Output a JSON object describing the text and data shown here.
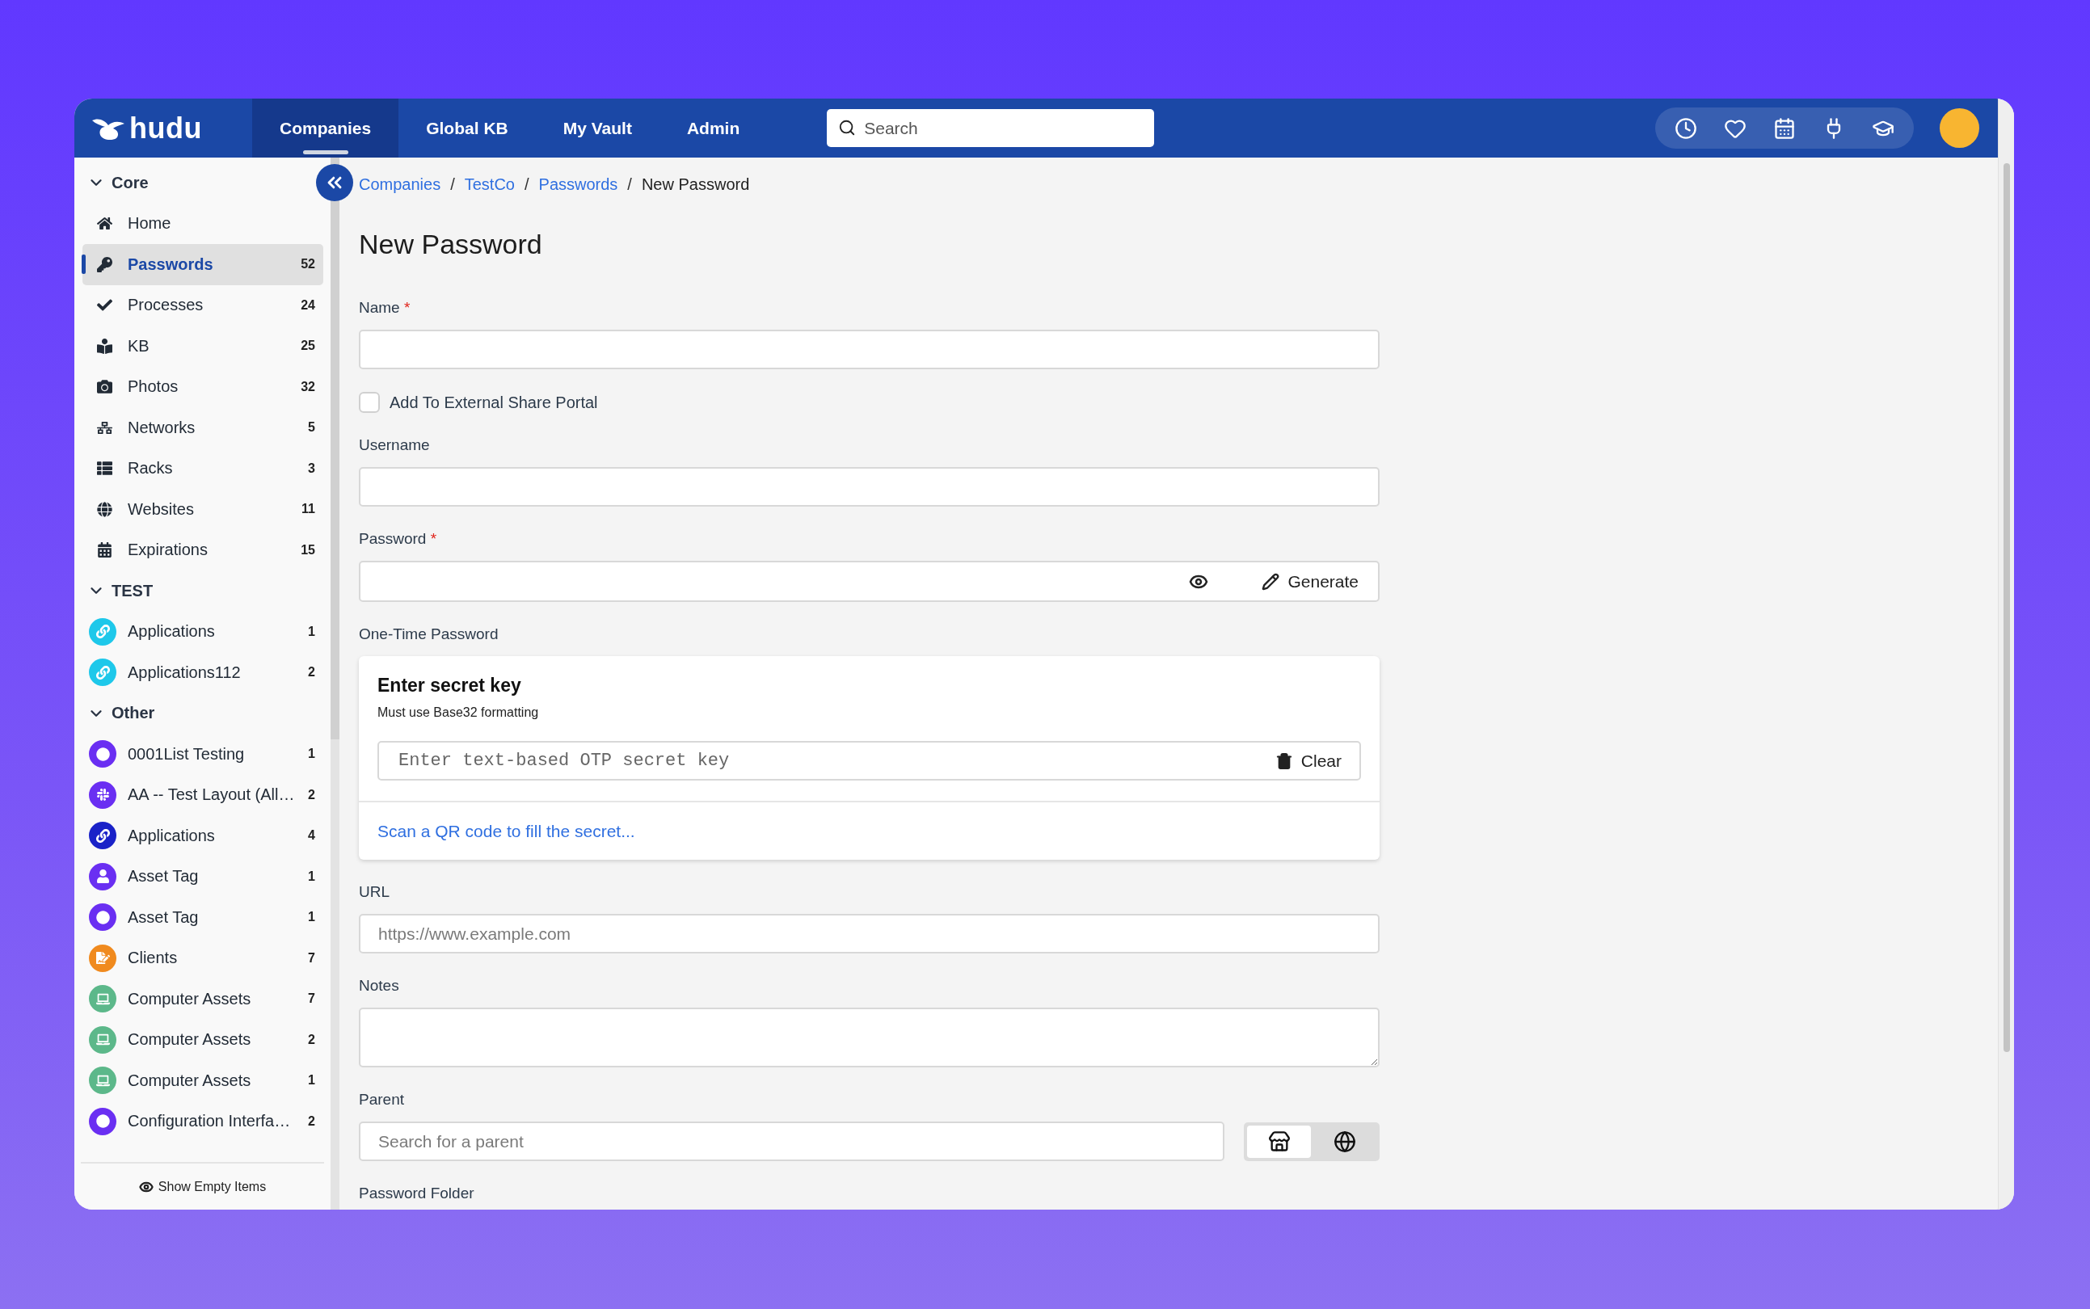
{
  "topnav": {
    "logo": "hudu",
    "tabs": [
      {
        "label": "Companies",
        "selected": true
      },
      {
        "label": "Global KB",
        "selected": false
      },
      {
        "label": "My Vault",
        "selected": false
      },
      {
        "label": "Admin",
        "selected": false
      }
    ],
    "search": {
      "placeholder": "Search"
    }
  },
  "sidebar": {
    "groups": [
      {
        "title": "Core",
        "expanded": true,
        "items": [
          {
            "kind": "glyph",
            "label": "Home",
            "selected": false
          },
          {
            "kind": "glyph",
            "label": "Passwords",
            "count": "52",
            "selected": true
          },
          {
            "kind": "glyph",
            "label": "Processes",
            "count": "24",
            "selected": false
          },
          {
            "kind": "glyph",
            "label": "KB",
            "count": "25",
            "selected": false
          },
          {
            "kind": "glyph",
            "label": "Photos",
            "count": "32",
            "selected": false
          },
          {
            "kind": "glyph",
            "label": "Networks",
            "count": "5",
            "selected": false
          },
          {
            "kind": "glyph",
            "label": "Racks",
            "count": "3",
            "selected": false
          },
          {
            "kind": "glyph",
            "label": "Websites",
            "count": "11",
            "selected": false
          },
          {
            "kind": "glyph",
            "label": "Expirations",
            "count": "15",
            "selected": false
          }
        ]
      },
      {
        "title": "TEST",
        "expanded": true,
        "items": [
          {
            "kind": "badge",
            "label": "Applications",
            "count": "1",
            "selected": false,
            "color": "#1ec8ea"
          },
          {
            "kind": "badge",
            "label": "Applications112",
            "count": "2",
            "selected": false,
            "color": "#1ec8ea"
          }
        ]
      },
      {
        "title": "Other",
        "expanded": true,
        "items": [
          {
            "kind": "badge",
            "label": "0001List Testing",
            "count": "1",
            "selected": false,
            "color": "#6a2ff2"
          },
          {
            "kind": "badge",
            "label": "AA -- Test Layout (All…",
            "count": "2",
            "selected": false,
            "color": "#6a2ff2"
          },
          {
            "kind": "badge",
            "label": "Applications",
            "count": "4",
            "selected": false,
            "color": "#1a22c8"
          },
          {
            "kind": "badge",
            "label": "Asset Tag",
            "count": "1",
            "selected": false,
            "color": "#6a2ff2"
          },
          {
            "kind": "badge",
            "label": "Asset Tag",
            "count": "1",
            "selected": false,
            "color": "#6a2ff2"
          },
          {
            "kind": "badge",
            "label": "Clients",
            "count": "7",
            "selected": false,
            "color": "#f08a1e"
          },
          {
            "kind": "badge",
            "label": "Computer Assets",
            "count": "7",
            "selected": false,
            "color": "#5cb88a"
          },
          {
            "kind": "badge",
            "label": "Computer Assets",
            "count": "2",
            "selected": false,
            "color": "#5cb88a"
          },
          {
            "kind": "badge",
            "label": "Computer Assets",
            "count": "1",
            "selected": false,
            "color": "#5cb88a"
          },
          {
            "kind": "badge",
            "label": "Configuration Interfa…",
            "count": "2",
            "selected": false,
            "color": "#6a2ff2"
          }
        ]
      }
    ],
    "footer": {
      "label": "Show Empty Items"
    }
  },
  "breadcrumb": {
    "separator": "/",
    "items": [
      {
        "label": "Companies",
        "link": true
      },
      {
        "label": "TestCo",
        "link": true
      },
      {
        "label": "Passwords",
        "link": true
      },
      {
        "label": "New Password",
        "link": false
      }
    ]
  },
  "title": "New Password",
  "fields": [
    {
      "kind": "text",
      "label": "Name",
      "required_mark": "*"
    },
    {
      "kind": "checkbox",
      "label": "Add To External Share Portal",
      "checked": false
    },
    {
      "kind": "text",
      "label": "Username"
    },
    {
      "kind": "password",
      "label": "Password",
      "required_mark": "*",
      "generate_label": "Generate"
    },
    {
      "kind": "otp",
      "label": "One-Time Password",
      "card_title": "Enter secret key",
      "card_hint": "Must use Base32 formatting",
      "placeholder": "Enter text-based OTP secret key",
      "clear_label": "Clear",
      "scan_link": "Scan a QR code to fill the secret..."
    },
    {
      "kind": "text",
      "label": "URL",
      "placeholder": "https://www.example.com"
    },
    {
      "kind": "textarea",
      "label": "Notes"
    },
    {
      "kind": "parent",
      "label": "Parent",
      "placeholder": "Search for a parent",
      "scopes": [
        {
          "selected": true
        },
        {
          "selected": false
        }
      ]
    },
    {
      "kind": "label_only",
      "label": "Password Folder"
    }
  ]
}
